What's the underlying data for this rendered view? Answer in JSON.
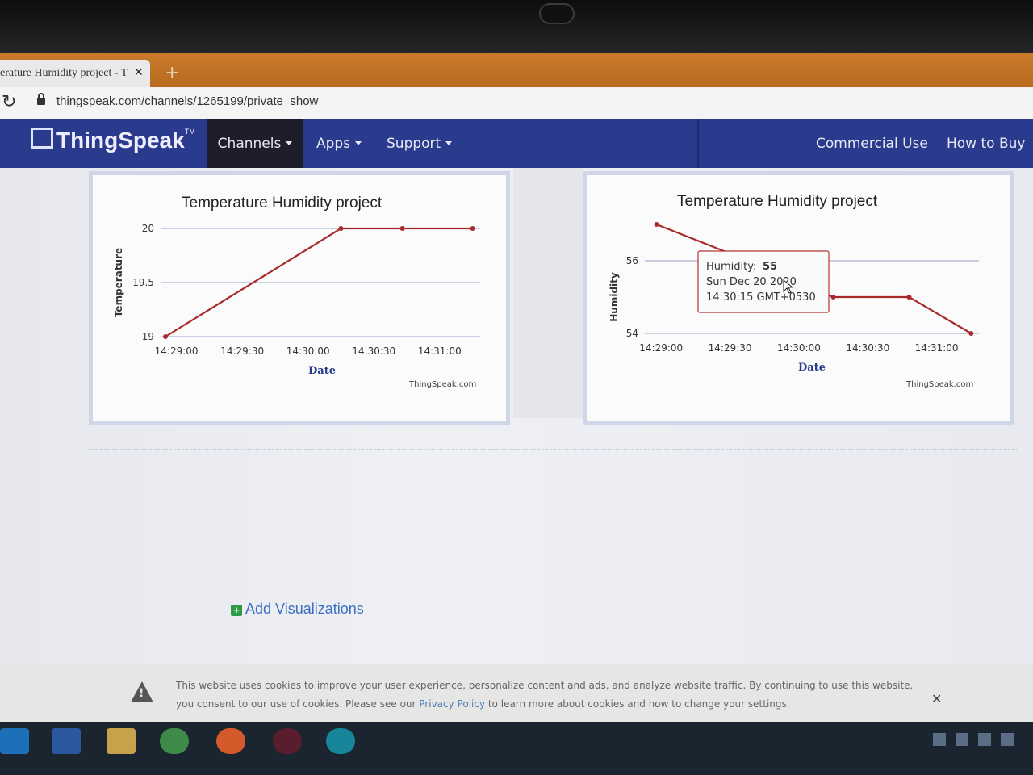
{
  "browser": {
    "tab_title": "erature Humidity project - T",
    "tab_close": "✕",
    "new_tab": "+",
    "url": "thingspeak.com/channels/1265199/private_show"
  },
  "navbar": {
    "logo": "ThingSpeak",
    "logo_tm": "TM",
    "items": [
      "Channels",
      "Apps",
      "Support"
    ],
    "right_items": [
      "Commercial Use",
      "How to Buy"
    ]
  },
  "charts": [
    {
      "title": "Temperature Humidity project",
      "ylabel": "Temperature",
      "xlabel": "Date",
      "credit": "ThingSpeak.com",
      "y_ticks": [
        "20",
        "19.5",
        "19"
      ],
      "x_ticks": [
        "14:29:00",
        "14:29:30",
        "14:30:00",
        "14:30:30",
        "14:31:00"
      ]
    },
    {
      "title": "Temperature Humidity project",
      "ylabel": "Humidity",
      "xlabel": "Date",
      "credit": "ThingSpeak.com",
      "y_ticks": [
        "56",
        "54"
      ],
      "x_ticks": [
        "14:29:00",
        "14:29:30",
        "14:30:00",
        "14:30:30",
        "14:31:00"
      ],
      "tooltip": {
        "label": "Humidity:",
        "value": "55",
        "line2": "Sun Dec 20 2020",
        "line3": "14:30:15 GMT+0530"
      }
    }
  ],
  "chart_data": [
    {
      "type": "line",
      "title": "Temperature Humidity project",
      "xlabel": "Date",
      "ylabel": "Temperature",
      "ylim": [
        19,
        20
      ],
      "x": [
        "14:28:55",
        "14:30:15",
        "14:30:43",
        "14:31:15"
      ],
      "series": [
        {
          "values": [
            19,
            20,
            20,
            20
          ],
          "color": "#a82a2a"
        }
      ]
    },
    {
      "type": "line",
      "title": "Temperature Humidity project",
      "xlabel": "Date",
      "ylabel": "Humidity",
      "ylim": [
        54,
        56
      ],
      "x": [
        "14:28:58",
        "14:29:30",
        "14:30:15",
        "14:30:48",
        "14:31:15"
      ],
      "series": [
        {
          "values": [
            57,
            56.2,
            55,
            55,
            54
          ],
          "color": "#a82a2a"
        }
      ]
    }
  ],
  "add_visualizations": "Add Visualizations",
  "cookie": {
    "line1": "This website uses cookies to improve your user experience, personalize content and ads, and analyze website traffic. By continuing to use this website,",
    "line2_pre": "you consent to our use of cookies. Please see our ",
    "link": "Privacy Policy",
    "line2_post": " to learn more about cookies and how to change your settings.",
    "close": "✕"
  },
  "taskbar": {
    "icons": [
      "internet-explorer-icon",
      "word-icon",
      "file-explorer-icon",
      "chrome-icon",
      "firefox-icon",
      "app-icon",
      "arduino-icon"
    ]
  },
  "colors": {
    "navbar": "#2a3b8d",
    "series": "#a82a2a",
    "link": "#3a6fc4"
  }
}
